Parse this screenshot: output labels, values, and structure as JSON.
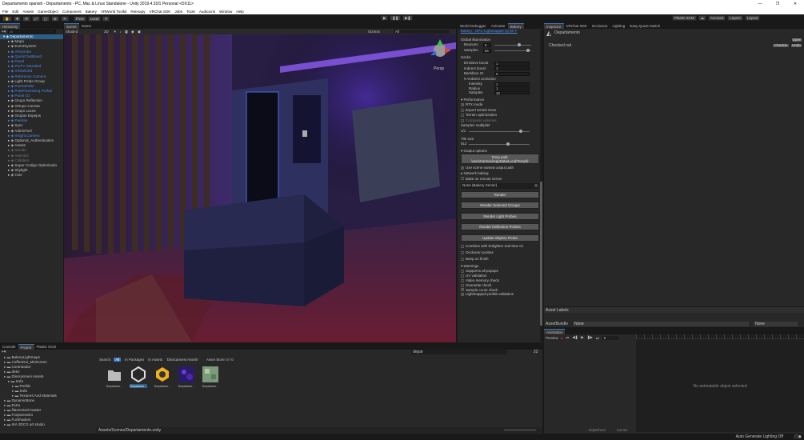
{
  "window": {
    "title": "Departamento spanish - Departamento - PC, Mac & Linux Standalone - Unity 2019.4.31f1 Personal <DX11>"
  },
  "menu": [
    "File",
    "Edit",
    "Assets",
    "GameObject",
    "Component",
    "Bakery",
    "VRWorld Toolkit",
    "Reimapy",
    "VRChat SDK",
    "Jobs",
    "Tools",
    "AudioLink",
    "Window",
    "Help"
  ],
  "toolbar": {
    "pivot": "Pivot",
    "local": "Local",
    "plastic": "Plastic SCM",
    "account": "Account",
    "layers": "Layers",
    "layout": "Layout"
  },
  "hierarchy": {
    "tab": "Hierarchy",
    "search_placeholder": "All",
    "root": "Departamento",
    "items": [
      {
        "label": "Mapa",
        "c": "n"
      },
      {
        "label": "EventSystem",
        "c": "n"
      },
      {
        "label": "VRoomba",
        "c": "b"
      },
      {
        "label": "QuickChatBoard",
        "c": "b"
      },
      {
        "label": "Panel",
        "c": "b"
      },
      {
        "label": "ProTV Standard",
        "c": "b"
      },
      {
        "label": "VRCWorld",
        "c": "b"
      },
      {
        "label": "Reference Camera",
        "c": "b"
      },
      {
        "label": "Light Probe Group",
        "c": "n"
      },
      {
        "label": "PuertaPatio",
        "c": "b"
      },
      {
        "label": "PostProcessing Prefab",
        "c": "b"
      },
      {
        "label": "Panel (1)",
        "c": "b"
      },
      {
        "label": "Grupo Reflection",
        "c": "n"
      },
      {
        "label": "GRupo Canvas",
        "c": "n"
      },
      {
        "label": "Grupo Luces",
        "c": "n"
      },
      {
        "label": "Grupos Espejos",
        "c": "n"
      },
      {
        "label": "Puertas",
        "c": "b"
      },
      {
        "label": "Sync",
        "c": "n"
      },
      {
        "label": "AdminTool",
        "c": "n"
      },
      {
        "label": "Insight.Camera",
        "c": "b"
      },
      {
        "label": "Optional_Authentication",
        "c": "n"
      },
      {
        "label": "Assets",
        "c": "n"
      },
      {
        "label": "Sonido",
        "c": "g"
      },
      {
        "label": "Asientos",
        "c": "g"
      },
      {
        "label": "Colliders",
        "c": "g"
      },
      {
        "label": "Super Codigo Optimizado",
        "c": "n"
      },
      {
        "label": "Skylight",
        "c": "n"
      },
      {
        "label": "Cine",
        "c": "n"
      }
    ]
  },
  "scene": {
    "tab_scene": "Scene",
    "tab_game": "Game",
    "shading": "Shaded",
    "mode": "2D",
    "gizmos": "Gizmos",
    "search": "All",
    "persp": "Persp"
  },
  "bakery": {
    "tabs": [
      "World Debugger",
      "Animator",
      "Bakery"
    ],
    "header": "Bakery - GPU Lightmapper by Mr F",
    "global_illumination": "Global Illumination",
    "bounces_label": "Bounces",
    "bounces": "5",
    "bounces_fill": 0.7,
    "samples_label": "Samples",
    "samples": "64",
    "samples_fill": 0.95,
    "hacks": "Hacks",
    "emissive_label": "Emissive boost",
    "emissive": "1",
    "indirect_label": "Indirect boost",
    "indirect": "1",
    "backface_label": "Backface GI",
    "backface": "0",
    "ao": "Ambient occlusion",
    "intensity_label": "Intensity",
    "intensity": "1",
    "radius_label": "Radius",
    "radius": "1",
    "aosamples_label": "Samples",
    "aosamples": "16",
    "performance": "Performance",
    "rtx": "RTX mode",
    "export_terrain": "Export terrain trees",
    "terrain_opt": "Terrain optimization",
    "compress": "Compress volumes",
    "samples_mult": "Samples multiplier",
    "samples_mult_val": "1/1",
    "samples_mult_fill": 0.88,
    "tile_size": "Tile size",
    "tile_val": "512",
    "tile_fill": 0.65,
    "output_options": "Output options",
    "temp_path_title": "Temp path:",
    "temp_path": "\\sers\\Carmesi\\AppData\\Local\\Temp\\fr",
    "use_scene_named": "Use scene named output path",
    "network_baking": "Network baking",
    "bake_remote": "Bake on remote server",
    "sector": "None (Bakery Sector)",
    "render": "Render",
    "render_selected": "Render Selected Groups",
    "render_probes": "Render Light Probes",
    "render_refl": "Render Reflection Probes",
    "update_skybox": "Update Skybox Probe",
    "combine": "Combine with Enlighten real-time GI",
    "occlusion": "Occlusion probes",
    "beep": "Beep on finish",
    "warnings": "Warnings",
    "warn_items": [
      {
        "label": "Suppress all popups",
        "checked": false
      },
      {
        "label": "UV validation",
        "checked": false
      },
      {
        "label": "Video memory check",
        "checked": false
      },
      {
        "label": "Overwrite check",
        "checked": false
      },
      {
        "label": "Sample count check",
        "checked": true
      },
      {
        "label": "Lightmapped prefab validation",
        "checked": true
      }
    ]
  },
  "inspector": {
    "tabs": [
      "Inspector",
      "VRChat SDK",
      "Occlusion",
      "Lighting",
      "Easy Quest Switch"
    ],
    "object": "Departamento",
    "open": "Open",
    "checked_out": "Checked out",
    "checkin": "Checkin",
    "undo": "Undo",
    "asset_labels": "Asset Labels",
    "asset_bundle": "AssetBundle",
    "bundle_val": "None",
    "variant_val": "None"
  },
  "animation": {
    "tab": "Animation",
    "preview": "Preview",
    "frame": "0",
    "empty": "No animatable object selected",
    "dopesheet": "Dopesheet",
    "curves": "Curves"
  },
  "project": {
    "tabs": [
      "Console",
      "Project",
      "Plastic SCM"
    ],
    "search": "depar",
    "folders": [
      "BakeryLightmaps",
      "CoffeeDot_MiniGreen",
      "Controlador",
      "deko",
      "Dioscarmesi Assets",
      "Sofa",
      "Prefab",
      "Sofa",
      "Textures And Materials",
      "DynamicBone",
      "Extra",
      "filamented-master",
      "Foxjaveranto",
      "FurShaders",
      "IKA 3DCG art studio"
    ],
    "scope_label": "Search:",
    "scope_all": "All",
    "scope_packages": "In Packages",
    "scope_assets": "In Assets",
    "scope_folder": "'Dioscarmesi Assets'",
    "asset_store": "Asset Store: 0 / 0",
    "assets": [
      {
        "label": "Departam...",
        "kind": "folder"
      },
      {
        "label": "Departam...",
        "kind": "unity"
      },
      {
        "label": "Departam...",
        "kind": "light"
      },
      {
        "label": "Departam...",
        "kind": "tex1"
      },
      {
        "label": "Departam...",
        "kind": "tex2"
      }
    ],
    "path": "Assets/Scenes/Departamento.unity",
    "count": "22"
  },
  "status": {
    "right": "Auto Generate Lighting Off"
  },
  "colors": {
    "accent": "#3a79bb",
    "link": "#4c8cf0",
    "purple": "#6a3cd8"
  }
}
